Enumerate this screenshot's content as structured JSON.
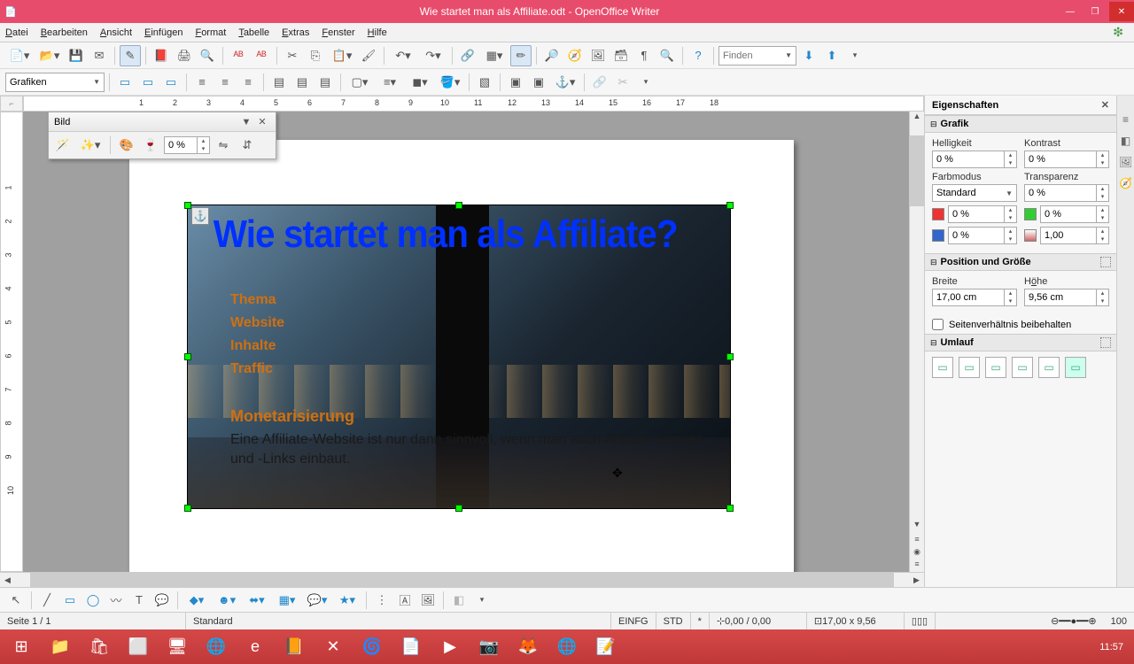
{
  "title": "Wie startet man als Affiliate.odt - OpenOffice Writer",
  "menu": {
    "file": "Datei",
    "edit": "Bearbeiten",
    "view": "Ansicht",
    "insert": "Einfügen",
    "format": "Format",
    "table": "Tabelle",
    "extras": "Extras",
    "window": "Fenster",
    "help": "Hilfe"
  },
  "search_placeholder": "Finden",
  "style_combo": "Grafiken",
  "bild_panel": {
    "title": "Bild",
    "value": "0 %"
  },
  "doc": {
    "heading": "Wie startet man als Affiliate?",
    "l1": "Thema",
    "l2": "Website",
    "l3": "Inhalte",
    "l4": "Traffic",
    "mon": "Monetarisierung",
    "para": "Eine Affiliate-Website ist nur dann sinnvoll, wenn man auch Affiliate-Banner und -Links einbaut."
  },
  "sidebar": {
    "title": "Eigenschaften",
    "grafik": "Grafik",
    "brightness": "Helligkeit",
    "brightness_v": "0 %",
    "contrast": "Kontrast",
    "contrast_v": "0 %",
    "colormode": "Farbmodus",
    "colormode_v": "Standard",
    "transparency": "Transparenz",
    "transparency_v": "0 %",
    "red_v": "0 %",
    "green_v": "0 %",
    "blue_v": "0 %",
    "gamma_v": "1,00",
    "possize": "Position und Größe",
    "width": "Breite",
    "width_v": "17,00 cm",
    "height": "Höhe",
    "height_v": "9,56 cm",
    "keepratio": "Seitenverhältnis beibehalten",
    "wrap": "Umlauf"
  },
  "status": {
    "page": "Seite 1 / 1",
    "style": "Standard",
    "insert": "EINFG",
    "sel": "STD",
    "mod": "*",
    "pos": "0,00 / 0,00",
    "size": "17,00 x 9,56",
    "zoom": "100"
  },
  "clock": {
    "time": "11:57"
  }
}
